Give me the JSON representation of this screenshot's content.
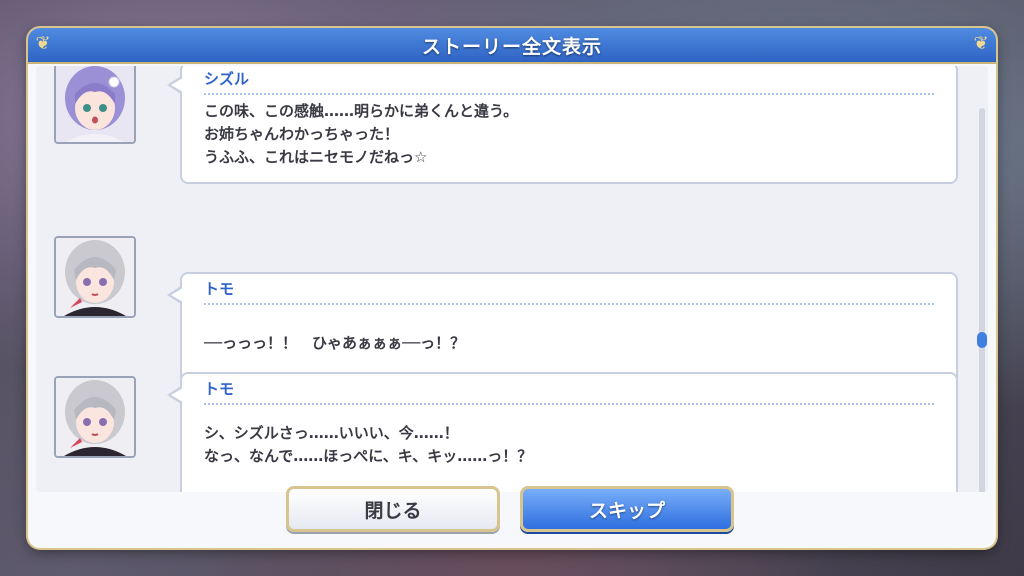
{
  "dialog": {
    "title": "ストーリー全文表示"
  },
  "entries": [
    {
      "speaker": "シズル",
      "lines": [
        "この味、この感触……明らかに弟くんと違う。",
        "お姉ちゃんわかっちゃった！",
        "うふふ、これはニセモノだねっ☆"
      ],
      "avatar_hair_color": "#9b8fd6"
    },
    {
      "speaker": "トモ",
      "lines": [
        "──っっっ！！　ひゃあぁぁぁ──っ！？"
      ],
      "avatar_hair_color": "#c9c9cf"
    },
    {
      "speaker": "トモ",
      "lines": [
        "シ、シズルさっ……いいい、今……！",
        "なっ、なんで……ほっぺに、キ、キッ……っ！？"
      ],
      "avatar_hair_color": "#c9c9cf"
    }
  ],
  "buttons": {
    "close_label": "閉じる",
    "skip_label": "スキップ"
  },
  "colors": {
    "title_blue": "#2f64c4",
    "speaker_blue": "#2f63c8",
    "gold_border": "#d7c48e",
    "skip_blue": "#2f6fe0"
  }
}
